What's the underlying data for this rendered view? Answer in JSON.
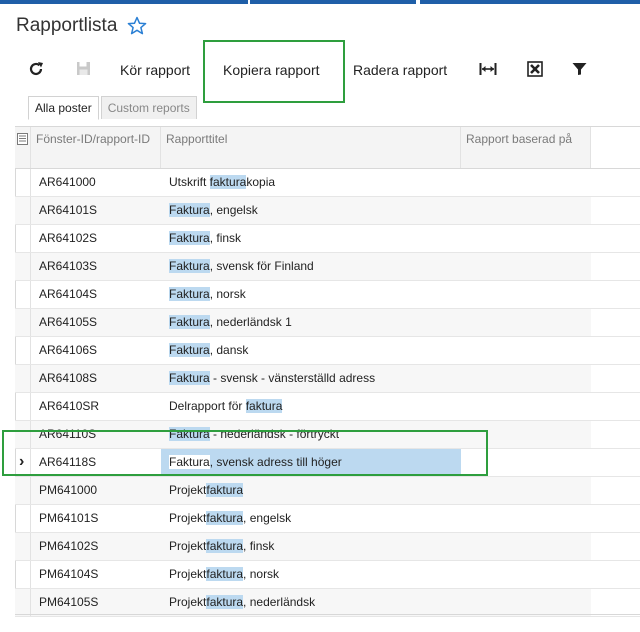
{
  "page": {
    "title": "Rapportlista"
  },
  "toolbar": {
    "refresh_icon": "refresh-icon",
    "save_icon": "save-icon",
    "run_label": "Kör rapport",
    "copy_label": "Kopiera rapport",
    "delete_label": "Radera rapport",
    "fit_icon": "fit-columns-icon",
    "export_icon": "excel-export-icon",
    "filter_icon": "filter-icon"
  },
  "tabs": [
    {
      "label": "Alla poster",
      "active": true
    },
    {
      "label": "Custom reports",
      "active": false
    }
  ],
  "grid": {
    "headers": {
      "id": "Fönster-ID/rapport-ID",
      "title": "Rapporttitel",
      "based": "Rapport baserad på"
    },
    "rows": [
      {
        "id": "AR641000",
        "pre": "Utskrift ",
        "mark": "faktura",
        "post": "kopia"
      },
      {
        "id": "AR64101S",
        "pre": "",
        "mark": "Faktura",
        "post": ", engelsk"
      },
      {
        "id": "AR64102S",
        "pre": "",
        "mark": "Faktura",
        "post": ", finsk"
      },
      {
        "id": "AR64103S",
        "pre": "",
        "mark": "Faktura",
        "post": ", svensk för Finland"
      },
      {
        "id": "AR64104S",
        "pre": "",
        "mark": "Faktura",
        "post": ", norsk"
      },
      {
        "id": "AR64105S",
        "pre": "",
        "mark": "Faktura",
        "post": ", nederländsk 1"
      },
      {
        "id": "AR64106S",
        "pre": "",
        "mark": "Faktura",
        "post": ", dansk"
      },
      {
        "id": "AR64108S",
        "pre": "",
        "mark": "Faktura",
        "post": " - svensk - vänsterställd adress"
      },
      {
        "id": "AR6410SR",
        "pre": "Delrapport för ",
        "mark": "faktura",
        "post": ""
      },
      {
        "id": "AR64110S",
        "pre": "",
        "mark": "Faktura",
        "post": " - nederländsk - förtryckt"
      },
      {
        "id": "AR64118S",
        "pre": "Faktura",
        "mark": "",
        "post": ", svensk adress till höger",
        "selected": true
      },
      {
        "id": "PM641000",
        "pre": "Projekt",
        "mark": "faktura",
        "post": ""
      },
      {
        "id": "PM64101S",
        "pre": "Projekt",
        "mark": "faktura",
        "post": ", engelsk"
      },
      {
        "id": "PM64102S",
        "pre": "Projekt",
        "mark": "faktura",
        "post": ", finsk"
      },
      {
        "id": "PM64104S",
        "pre": "Projekt",
        "mark": "faktura",
        "post": ", norsk"
      },
      {
        "id": "PM64105S",
        "pre": "Projekt",
        "mark": "faktura",
        "post": ", nederländsk"
      }
    ]
  },
  "colors": {
    "accent": "#1f5fa8",
    "highlight": "#bcd9f0",
    "callout": "#2e9e3e",
    "star": "#2a7fd4"
  }
}
